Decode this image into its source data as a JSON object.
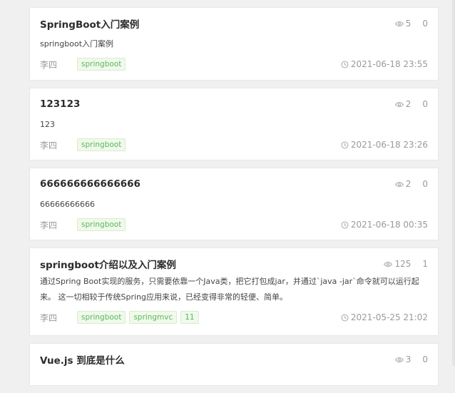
{
  "posts": [
    {
      "title": "SpringBoot入门案例",
      "summary": "springboot入门案例",
      "author": "李四",
      "tags": [
        "springboot"
      ],
      "views": "5",
      "comments": "0",
      "date": "2021-06-18 23:55"
    },
    {
      "title": "123123",
      "summary": "123",
      "author": "李四",
      "tags": [
        "springboot"
      ],
      "views": "2",
      "comments": "0",
      "date": "2021-06-18 23:26"
    },
    {
      "title": "666666666666666",
      "summary": "66666666666",
      "author": "李四",
      "tags": [
        "springboot"
      ],
      "views": "2",
      "comments": "0",
      "date": "2021-06-18 00:35"
    },
    {
      "title": "springboot介绍以及入门案例",
      "summary": "通过Spring Boot实现的服务，只需要依靠一个Java类，把它打包成jar，并通过`java -jar`命令就可以运行起来。 这一切相较于传统Spring应用来说，已经变得非常的轻便、简单。",
      "author": "李四",
      "tags": [
        "springboot",
        "springmvc",
        "11"
      ],
      "views": "125",
      "comments": "1",
      "date": "2021-05-25 21:02"
    },
    {
      "title": "Vue.js 到底是什么",
      "summary": "",
      "author": "",
      "tags": [],
      "views": "3",
      "comments": "0",
      "date": ""
    }
  ],
  "icons": {
    "views": "eye-icon",
    "date": "clock-icon"
  }
}
